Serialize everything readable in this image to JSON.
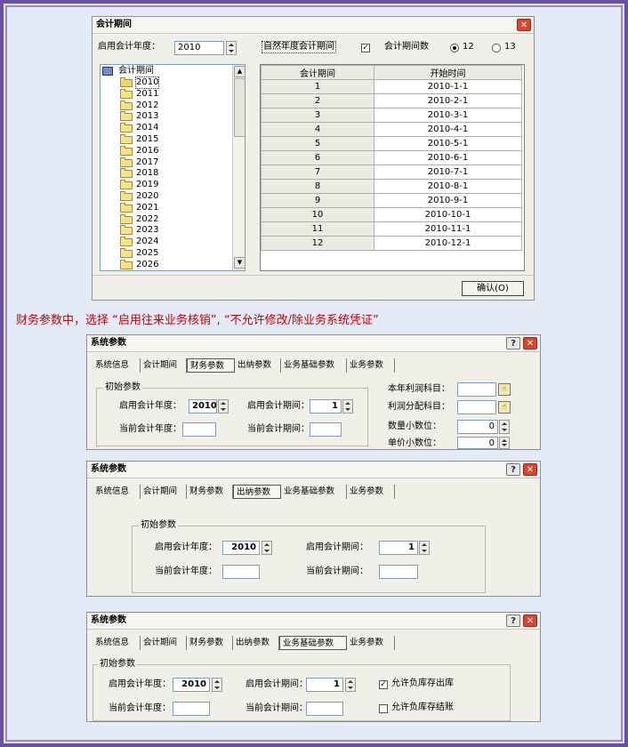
{
  "dialog1": {
    "title": "会计期间",
    "start_year_label": "启用会计年度：",
    "start_year_value": "2010",
    "natural_year_label": "自然年度会计期间",
    "period_count_label": "会计期间数",
    "radio_12": "12",
    "radio_13": "13",
    "tree_root": "会计期间",
    "tree_years": [
      "2010",
      "2011",
      "2012",
      "2013",
      "2014",
      "2015",
      "2016",
      "2017",
      "2018",
      "2019",
      "2020",
      "2021",
      "2022",
      "2023",
      "2024",
      "2025",
      "2026"
    ],
    "table_headers": [
      "会计期间",
      "开始时间"
    ],
    "table_rows": [
      [
        "1",
        "2010-1-1"
      ],
      [
        "2",
        "2010-2-1"
      ],
      [
        "3",
        "2010-3-1"
      ],
      [
        "4",
        "2010-4-1"
      ],
      [
        "5",
        "2010-5-1"
      ],
      [
        "6",
        "2010-6-1"
      ],
      [
        "7",
        "2010-7-1"
      ],
      [
        "8",
        "2010-8-1"
      ],
      [
        "9",
        "2010-9-1"
      ],
      [
        "10",
        "2010-10-1"
      ],
      [
        "11",
        "2010-11-1"
      ],
      [
        "12",
        "2010-12-1"
      ]
    ],
    "confirm_label": "确认(O)"
  },
  "note_text": "财务参数中，选择 “启用往来业务核销”, “不允许修改/除业务系统凭证”",
  "tabs": [
    "系统信息",
    "会计期间",
    "财务参数",
    "出纳参数",
    "业务基础参数",
    "业务参数"
  ],
  "dialog2": {
    "title": "系统参数",
    "group": "初始参数",
    "start_year_label": "启用会计年度：",
    "start_year_value": "2010",
    "start_period_label": "启用会计期间：",
    "start_period_value": "1",
    "cur_year_label": "当前会计年度：",
    "cur_period_label": "当前会计期间：",
    "profit_label": "本年利润科目：",
    "dist_label": "利润分配科目：",
    "qty_dec_label": "数量小数位：",
    "qty_dec_value": "0",
    "price_dec_label": "单价小数位：",
    "price_dec_value": "0"
  },
  "dialog3": {
    "title": "系统参数",
    "group": "初始参数",
    "start_year_label": "启用会计年度：",
    "start_year_value": "2010",
    "start_period_label": "启用会计期间：",
    "start_period_value": "1",
    "cur_year_label": "当前会计年度：",
    "cur_period_label": "当前会计期间："
  },
  "dialog4": {
    "title": "系统参数",
    "group": "初始参数",
    "start_year_label": "启用会计年度：",
    "start_year_value": "2010",
    "start_period_label": "启用会计期间：",
    "start_period_value": "1",
    "cur_year_label": "当前会计年度：",
    "cur_period_label": "当前会计期间：",
    "allow_neg_out": "允许负库存出库",
    "allow_neg_close": "允许负库存结账"
  }
}
